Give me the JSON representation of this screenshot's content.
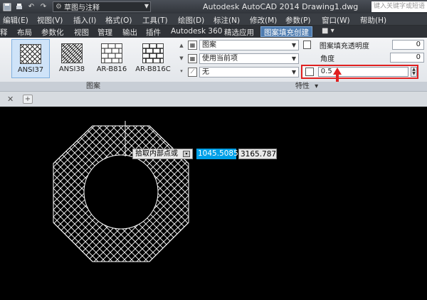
{
  "titlebar": {
    "workspace": "草图与注释",
    "app_title": "Autodesk AutoCAD 2014    Drawing1.dwg",
    "search_placeholder": "键入关键字或短语"
  },
  "menubar": {
    "items": [
      "编辑(E)",
      "视图(V)",
      "插入(I)",
      "格式(O)",
      "工具(T)",
      "绘图(D)",
      "标注(N)",
      "修改(M)",
      "参数(P)",
      "窗口(W)",
      "帮助(H)"
    ]
  },
  "ribbon_tabs": {
    "items": [
      "释",
      "布局",
      "参数化",
      "视图",
      "管理",
      "输出",
      "插件",
      "Autodesk 360",
      "精选应用"
    ],
    "active": "图案填充创建"
  },
  "pattern_panel": {
    "label": "图案",
    "patterns": [
      "ANSI37",
      "ANSI38",
      "AR-B816",
      "AR-B816C"
    ],
    "selected": "ANSI37"
  },
  "properties_panel": {
    "type_value": "图案",
    "color_value": "使用当前项",
    "bg_value": "无",
    "transparency_label": "图案填充透明度",
    "transparency_value": "0",
    "angle_label": "角度",
    "angle_value": "0",
    "scale_value": "0.5",
    "footer_label": "特性"
  },
  "canvas": {
    "prompt": "拾取内部点或",
    "coord_x": "1045.5085",
    "coord_y": "3165.7873"
  },
  "colors": {
    "highlight_border": "#e02020",
    "active_tab": "#4e7cb0",
    "coord_highlight": "#00a0e8"
  }
}
